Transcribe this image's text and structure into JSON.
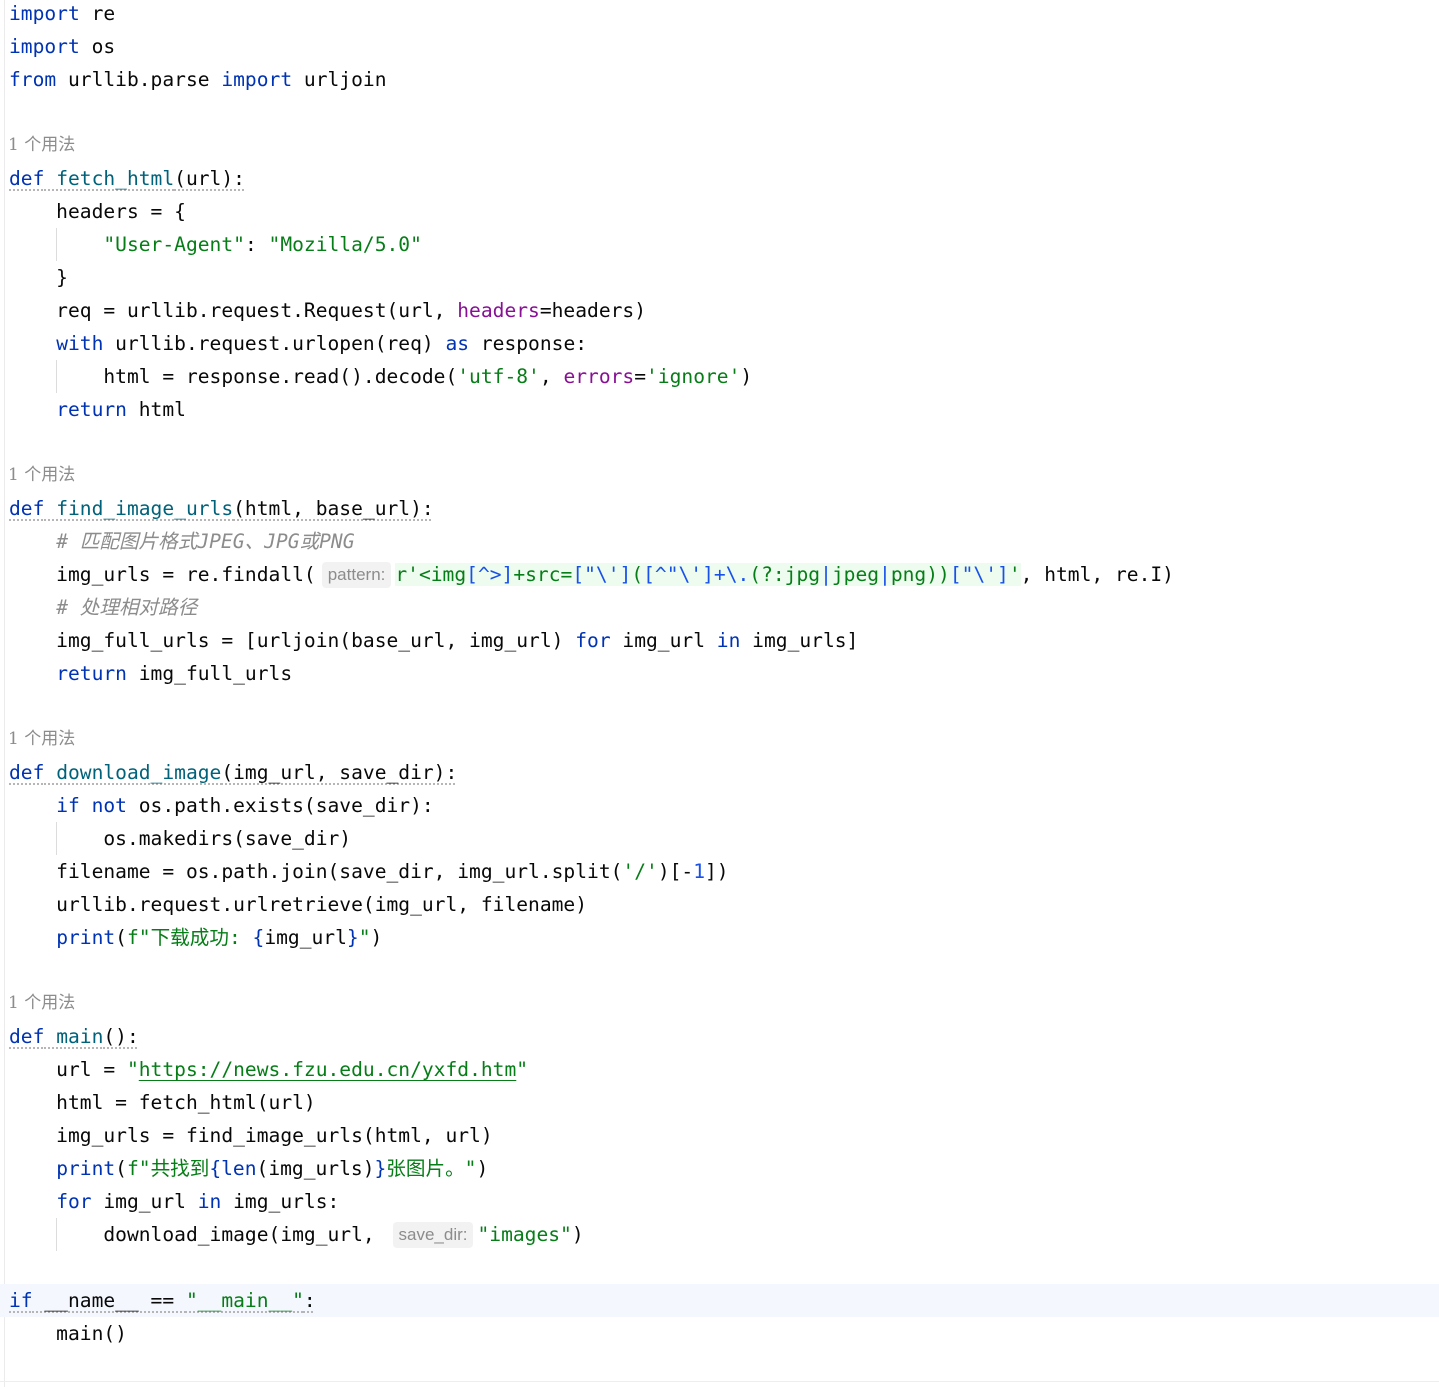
{
  "editor": {
    "usage_hint": "1 个用法",
    "lines": {
      "l1": [
        "import",
        " re"
      ],
      "l2": [
        "import",
        " os"
      ],
      "l3": [
        "from",
        " urllib.parse ",
        "import",
        " urljoin"
      ],
      "l5": [
        "def",
        " ",
        "fetch_html",
        "(url):"
      ],
      "l6": [
        "    headers = {"
      ],
      "l7": [
        "        ",
        "\"User-Agent\"",
        ": ",
        "\"Mozilla/5.0\""
      ],
      "l8": [
        "    }"
      ],
      "l9": [
        "    req = urllib.request.Request(url, ",
        "headers",
        "=headers)"
      ],
      "l10": [
        "    ",
        "with",
        " urllib.request.urlopen(req) ",
        "as",
        " response:"
      ],
      "l11": [
        "        html = response.read().decode(",
        "'utf-8'",
        ", ",
        "errors",
        "=",
        "'ignore'",
        ")"
      ],
      "l12": [
        "    ",
        "return",
        " html"
      ],
      "l14": [
        "def",
        " ",
        "find_image_urls",
        "(html, base_url):"
      ],
      "l15": [
        "    ",
        "# ",
        "匹配图片格式",
        "JPEG",
        "、",
        "JPG",
        "或",
        "PNG"
      ],
      "l16": [
        "    img_urls = re.findall(",
        "pattern:",
        "r'<img",
        "[^>]",
        "+src=",
        "[\"\\']",
        "(",
        "[^\"\\']",
        "+",
        "\\.",
        "(?:",
        "jpg",
        "|",
        "jpeg",
        "|",
        "png",
        "))",
        "[\"\\']",
        "'",
        ", html, re.I)"
      ],
      "l17": [
        "    ",
        "# ",
        "处理相对路径"
      ],
      "l18": [
        "    img_full_urls = [urljoin(base_url, img_url) ",
        "for",
        " img_url ",
        "in",
        " img_urls]"
      ],
      "l19": [
        "    ",
        "return",
        " img_full_urls"
      ],
      "l21": [
        "def",
        " ",
        "download_image",
        "(img_url, save_dir):"
      ],
      "l22": [
        "    ",
        "if",
        " ",
        "not",
        " os.path.exists(save_dir):"
      ],
      "l23": [
        "        os.makedirs(save_dir)"
      ],
      "l24": [
        "    filename = os.path.join(save_dir, img_url.split(",
        "'/'",
        ")[-",
        "1",
        "])"
      ],
      "l25": [
        "    urllib.request.urlretrieve(img_url, filename)"
      ],
      "l26": [
        "    ",
        "print",
        "(",
        "f\"",
        "下载成功",
        ": ",
        "{",
        "img_url",
        "}",
        "\"",
        ")"
      ],
      "l28": [
        "def",
        " ",
        "main",
        "():"
      ],
      "l29": [
        "    url = ",
        "\"",
        "https://news.fzu.edu.cn/yxfd.htm",
        "\""
      ],
      "l30": [
        "    html = fetch_html(url)"
      ],
      "l31": [
        "    img_urls = find_image_urls(html, url)"
      ],
      "l32": [
        "    ",
        "print",
        "(",
        "f\"",
        "共找到",
        "{",
        "len",
        "(img_urls)",
        "}",
        "张图片。",
        "\"",
        ")"
      ],
      "l33": [
        "    ",
        "for",
        " img_url ",
        "in",
        " img_urls:"
      ],
      "l34": [
        "        download_image(img_url, ",
        "save_dir:",
        "\"images\"",
        ")"
      ],
      "l36": [
        "if",
        " __name__ == ",
        "\"__main__\"",
        ":"
      ],
      "l37": [
        "    main()"
      ]
    }
  }
}
